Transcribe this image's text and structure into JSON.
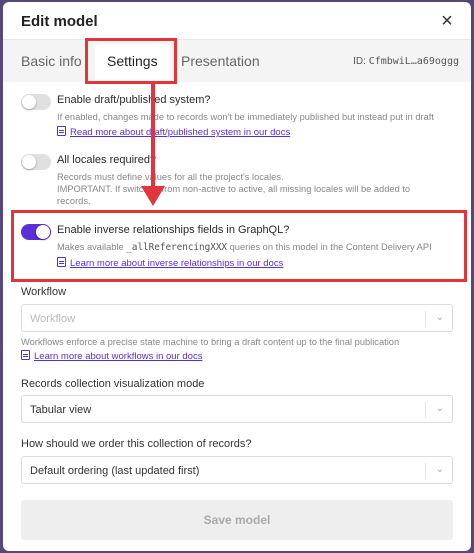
{
  "window": {
    "title": "Edit model",
    "close_label": "×"
  },
  "tabs": [
    {
      "label": "Basic info",
      "active": false
    },
    {
      "label": "Settings",
      "active": true
    },
    {
      "label": "Presentation",
      "active": false
    }
  ],
  "model_id": {
    "prefix": "ID:",
    "value": "CfmbwiL…a69oggg"
  },
  "options": {
    "draft": {
      "title": "Enable draft/published system?",
      "enabled": false,
      "desc_line1": "If enabled, changes made to records won't be immediately published but instead put in draft",
      "link": "Read more about draft/published system in our docs"
    },
    "locales": {
      "title": "All locales required?",
      "enabled": false,
      "desc_line1": "Records must define values for all the project's locales.",
      "desc_line2": "IMPORTANT. If switched from non-active to active, all missing locales will be added to",
      "desc_line3": "records."
    },
    "inverse": {
      "title": "Enable inverse relationships fields in GraphQL?",
      "enabled": true,
      "desc_before": "Makes available",
      "desc_code": "_allReferencingXXX",
      "desc_after": "queries on this model in the Content Delivery API",
      "link": "Learn more about inverse relationships in our docs"
    }
  },
  "workflow": {
    "label": "Workflow",
    "placeholder": "Workflow",
    "desc": "Workflows enforce a precise state machine to bring a draft content up to the final publication",
    "link": "Learn more about workflows in our docs"
  },
  "collection_mode": {
    "label": "Records collection visualization mode",
    "value": "Tabular view"
  },
  "ordering": {
    "label": "How should we order this collection of records?",
    "value": "Default ordering (last updated first)"
  },
  "save_label": "Save model",
  "colors": {
    "accent": "#5a2ed9",
    "highlight": "#e0353b",
    "backdrop": "#58477a"
  }
}
